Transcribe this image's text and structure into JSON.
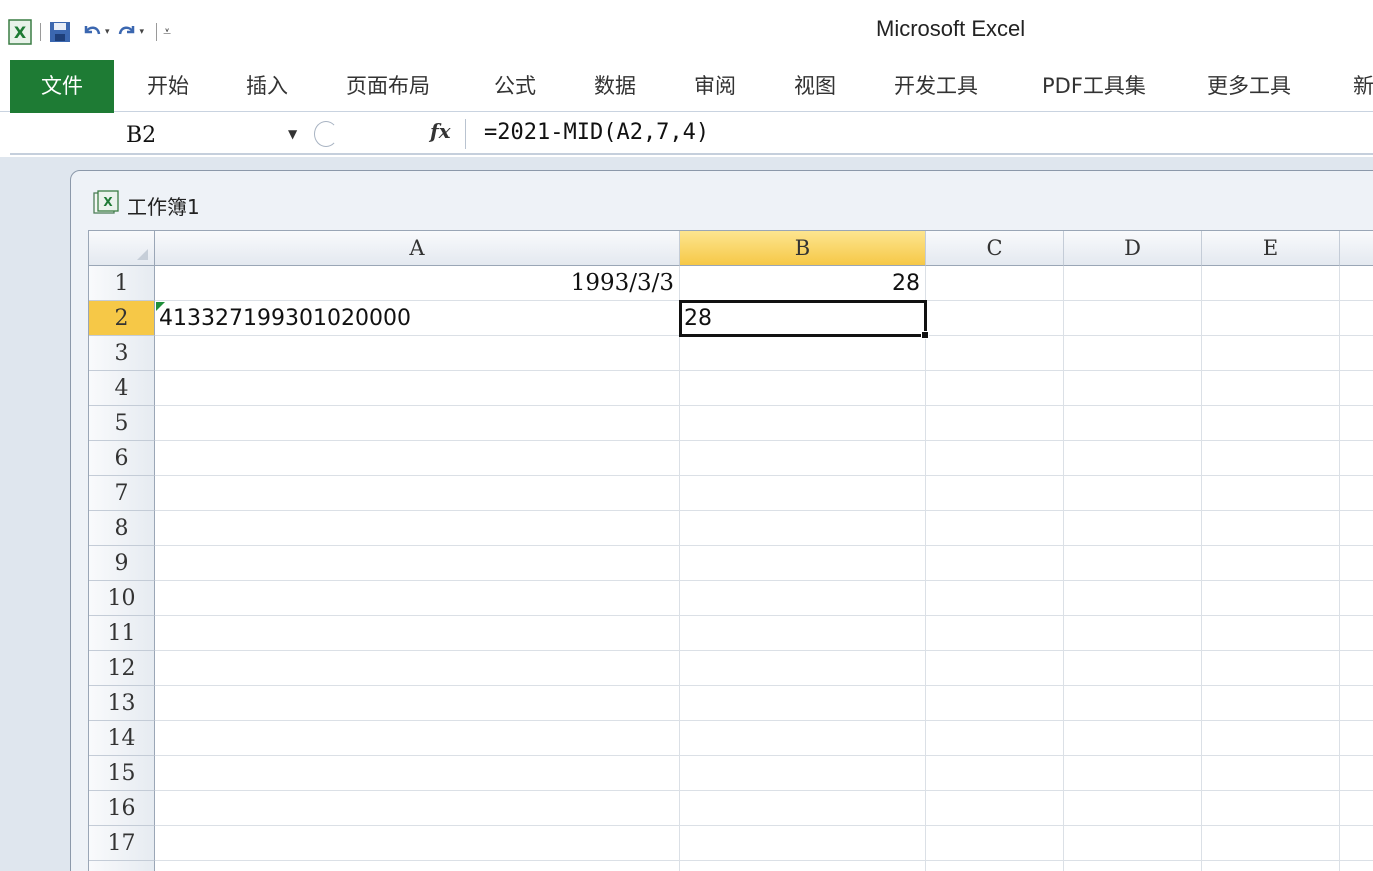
{
  "app": {
    "title": "Microsoft Excel"
  },
  "qat": {
    "icons": [
      "excel-app-icon",
      "save-icon",
      "undo-icon",
      "redo-icon",
      "customize-qat-icon"
    ]
  },
  "ribbon": {
    "tabs": [
      "文件",
      "开始",
      "插入",
      "页面布局",
      "公式",
      "数据",
      "审阅",
      "视图",
      "开发工具",
      "PDF工具集",
      "更多工具",
      "新"
    ],
    "colors": {
      "file_tab": "#1e7b34",
      "active_header": "#f6c847"
    }
  },
  "formula_bar": {
    "name_box": "B2",
    "fx_label": "fx",
    "formula": "=2021-MID(A2,7,4)"
  },
  "workbook": {
    "title": "工作簿1"
  },
  "grid": {
    "columns": [
      "A",
      "B",
      "C",
      "D",
      "E"
    ],
    "active_column": "B",
    "rows": [
      "1",
      "2",
      "3",
      "4",
      "5",
      "6",
      "7",
      "8",
      "9",
      "10",
      "11",
      "12",
      "13",
      "14",
      "15",
      "16",
      "17"
    ],
    "active_row": "2",
    "cells": {
      "A1": "1993/3/3",
      "B1": "28",
      "A2": "413327199301020000",
      "B2": "28"
    }
  }
}
